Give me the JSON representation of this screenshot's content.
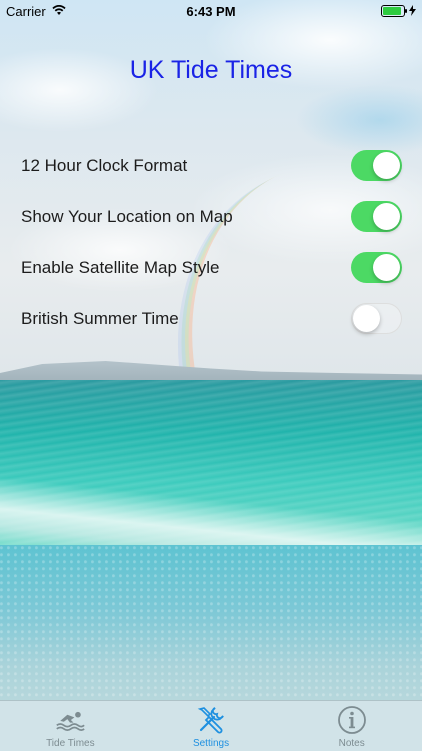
{
  "status_bar": {
    "carrier": "Carrier",
    "time": "6:43 PM",
    "battery_level": 1.0
  },
  "app": {
    "title": "UK Tide Times"
  },
  "settings": {
    "items": [
      {
        "label": "12 Hour Clock Format",
        "enabled": true
      },
      {
        "label": "Show Your Location on Map",
        "enabled": true
      },
      {
        "label": "Enable Satellite Map Style",
        "enabled": true
      },
      {
        "label": "British Summer Time",
        "enabled": false
      }
    ]
  },
  "tabbar": {
    "tabs": [
      {
        "label": "Tide Times",
        "icon": "swimmer-icon",
        "active": false
      },
      {
        "label": "Settings",
        "icon": "tools-icon",
        "active": true
      },
      {
        "label": "Notes",
        "icon": "info-icon",
        "active": false
      }
    ]
  },
  "colors": {
    "title": "#1a23e6",
    "switch_on": "#4cd964",
    "tab_active": "#1e90e0",
    "tab_inactive": "#7d8c91"
  }
}
